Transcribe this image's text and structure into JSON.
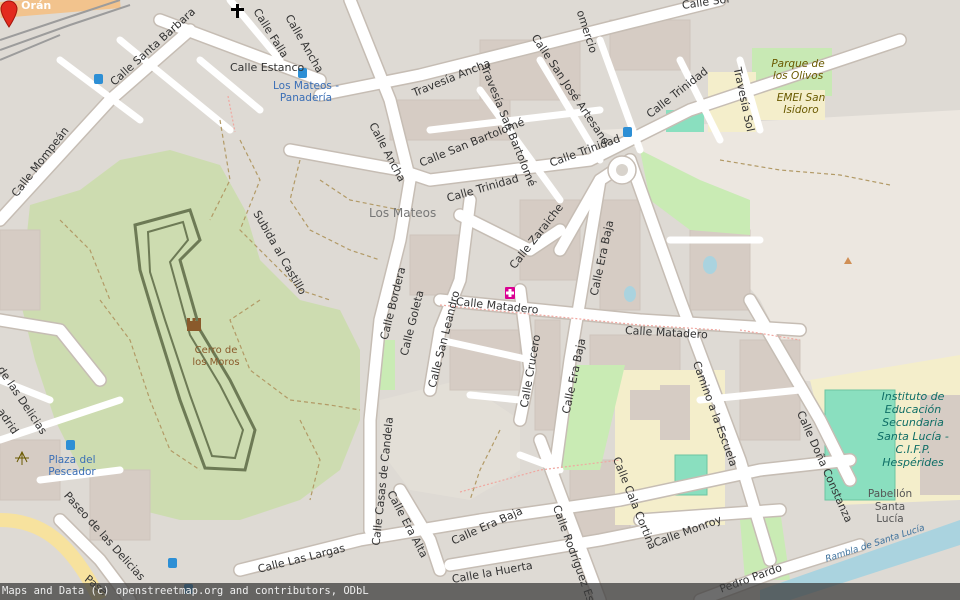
{
  "streets": {
    "oran": "de Orán",
    "falla": "Calle Falla",
    "ancha_top": "Calle Ancha",
    "ancha_mid": "Calle Ancha",
    "travesia_ancha": "Travesía Ancha",
    "san_jose_artesano": "Calle San José Artesano",
    "comercio": "omercio",
    "sol": "Calle Sol",
    "santa_barbara": "Calle Santa Barbara",
    "estanco": "Calle Estanco",
    "travesia_san_bartolome": "Travesía San Bartolomé",
    "calle_san_bartolome": "Calle San Bartolomé",
    "trinidad_upper": "Calle Trinidad",
    "trinidad_mid": "Calle Trinidad",
    "trinidad_lower": "Calle Trinidad",
    "travesia_sol": "Travesía Sol",
    "mompean": "Calle Mompeán",
    "subida_castillo": "Subida al Castillo",
    "zaraiche": "Calle Zaraiche",
    "era_baja_top": "Calle Era Baja",
    "bordera": "Calle Bordera",
    "goleta": "Calle Goleta",
    "san_leandro": "Calle San Leandro",
    "matadero_main": "Calle Matadero",
    "matadero_east": "Calle Matadero",
    "crucero": "Calle Crucero",
    "era_baja_mid": "Calle Era Baja",
    "camino_escuela": "Camino a la Escuela",
    "dona_constanza": "Calle Doña Constanza",
    "casas_candela": "Calle Casas de Candela",
    "era_alta": "Calle Era Alta",
    "era_baja_bottom": "Calle Era Baja",
    "cala_cortina": "Calle Cala Cortina",
    "rodriguez": "Calle Rodríguez Escot",
    "monroy": "Calle Monroy",
    "las_largas": "Calle Las Largas",
    "la_huerta": "Calle la Huerta",
    "pedro_pardo": "Pedro Pardo",
    "paseo_delicias": "Paseo de las Delicias",
    "paseo_short": "Pase",
    "delicias_left": "de las Delicias",
    "madrid": "adrid",
    "rambla": "Rambla de Santa Lucía"
  },
  "places": {
    "los_mateos": "Los Mateos",
    "bus_stop_panaderia": "Los Mateos - Panadería",
    "parque_olivos": "Parque de los Olivos",
    "emei": "EMEI San Isidoro",
    "cerro_moros": "Cerro de los Moros",
    "plaza_pescador": "Plaza del Pescador",
    "instituto": "Instituto de Educación Secundaria Santa Lucía - C.I.F.P. Hespérides",
    "pabellon": "Pabellón Santa Lucía"
  },
  "icons": {
    "marker": "map-pin-icon",
    "pharmacy": "pharmacy-icon",
    "church": "church-cross-icon",
    "castle": "castle-icon",
    "bus": "bus-stop-icon",
    "peak": "peak-icon"
  },
  "colors": {
    "road": "#ffffff",
    "ground": "#e0dcd6",
    "residential": "#d9d0c9",
    "park": "#c8d9a8",
    "grass": "#cdebb0",
    "school": "#f7efb7",
    "pitch": "#88e0be",
    "marker": "#e32b1e"
  },
  "attribution": "Maps and Data (c) openstreetmap.org and contributors, ODbL"
}
